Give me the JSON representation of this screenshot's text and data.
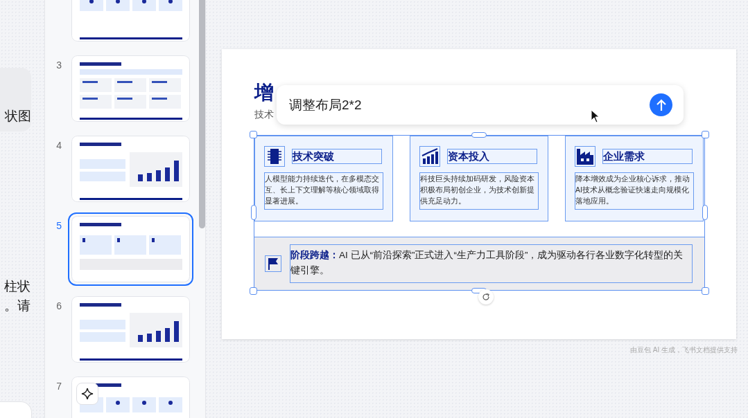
{
  "chat": {
    "bubble_text": "状图",
    "message_lines": [
      "柱状",
      "。请"
    ]
  },
  "thumbnails": [
    {
      "kind": "icons",
      "selected": false
    },
    {
      "number": "3",
      "kind": "grid",
      "selected": false
    },
    {
      "number": "4",
      "kind": "chart",
      "selected": false
    },
    {
      "number": "5",
      "kind": "cards",
      "selected": true
    },
    {
      "number": "6",
      "kind": "chart",
      "selected": false
    },
    {
      "number": "7",
      "kind": "icons",
      "selected": false
    }
  ],
  "slide": {
    "title": "增",
    "subtitle": "技术",
    "cards": [
      {
        "kind": "chip",
        "title": "技术突破",
        "body": "人模型能力持续迭代，在多模态交互、长上下文理解等核心领域取得显著进展。"
      },
      {
        "kind": "chart",
        "title": "资本投入",
        "body": "科技巨头持续加码研发，风险资本积极布局初创企业，为技术创新提供充足动力。"
      },
      {
        "kind": "factory",
        "title": "企业需求",
        "body": "降本增效成为企业核心诉求，推动AI技术从概念验证快速走向规模化落地应用。"
      }
    ],
    "banner": {
      "text": "**阶段跨越：**AI 已从“前沿探索”正式进入“生产力工具阶段”，成为驱动各行各业数字化转型的关键引擎。"
    }
  },
  "prompt": {
    "value": "调整布局2*2"
  },
  "footer": "由豆包 AI 生成，飞书文档提供支持"
}
